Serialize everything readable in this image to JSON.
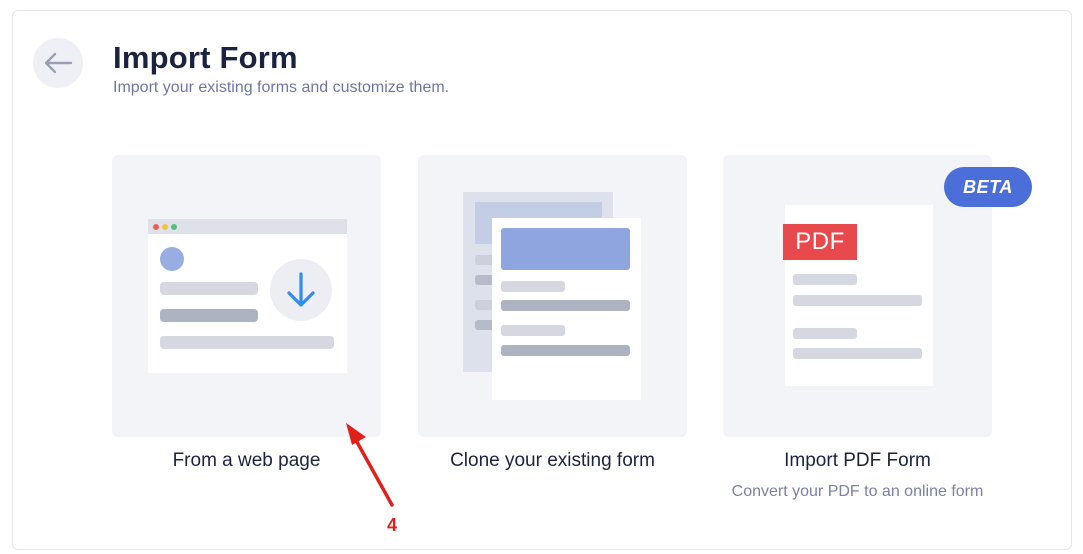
{
  "header": {
    "title": "Import Form",
    "subtitle": "Import your existing forms and customize them.",
    "back_icon": "arrow-left-icon"
  },
  "options": [
    {
      "label": "From a web page",
      "icon": "web-page-download-illustration"
    },
    {
      "label": "Clone your existing form",
      "icon": "cloned-form-illustration"
    },
    {
      "label": "Import PDF Form",
      "description": "Convert your PDF to an online form",
      "badge": "BETA",
      "pdf_tag": "PDF",
      "icon": "pdf-document-illustration"
    }
  ],
  "annotation": {
    "number": "4",
    "color": "#e0201a"
  },
  "colors": {
    "accent": "#4b6ed8",
    "pdf_red": "#e8494d",
    "download_blue": "#2f8cf0",
    "card_bg": "#f3f4f8"
  }
}
